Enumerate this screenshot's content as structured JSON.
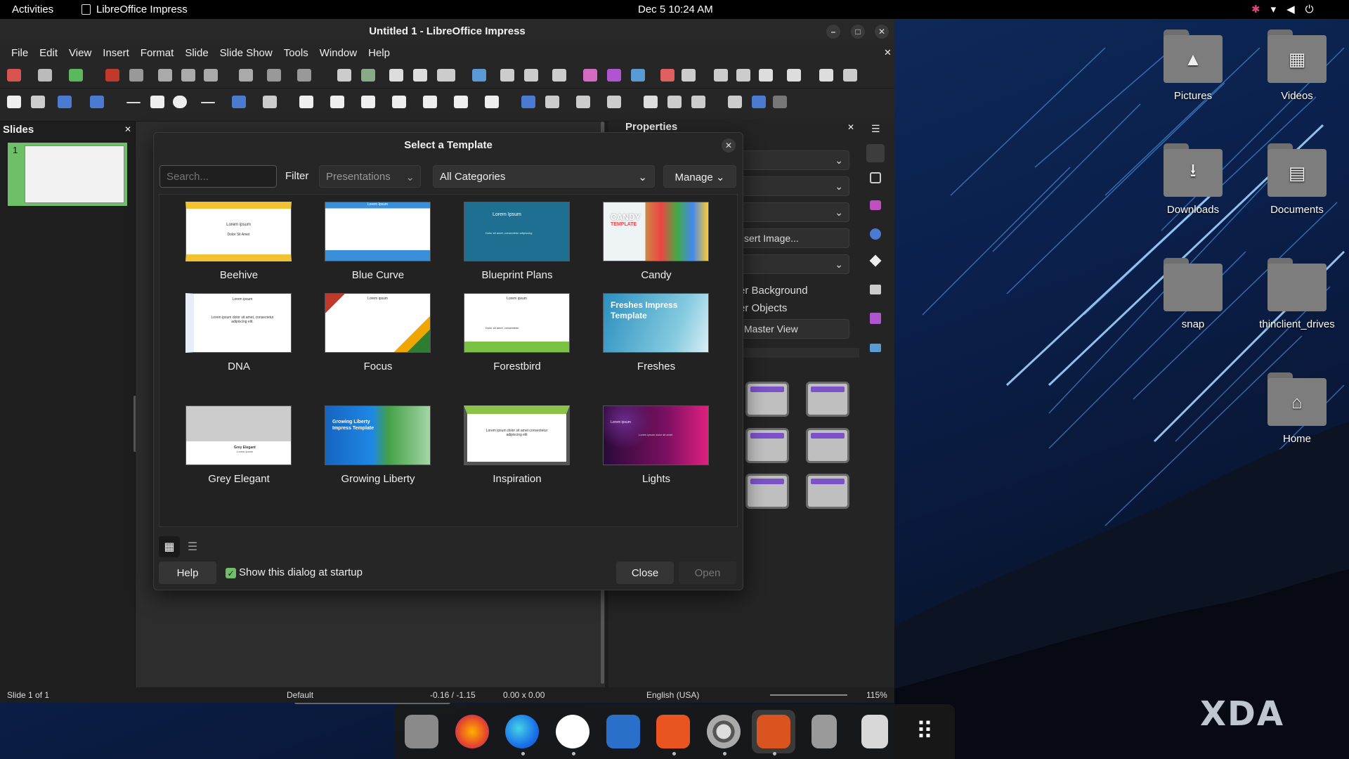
{
  "topbar": {
    "activities": "Activities",
    "app_name": "LibreOffice Impress",
    "clock": "Dec 5  10:24 AM"
  },
  "window": {
    "title": "Untitled 1 - LibreOffice Impress"
  },
  "menu": [
    "File",
    "Edit",
    "View",
    "Insert",
    "Format",
    "Slide",
    "Slide Show",
    "Tools",
    "Window",
    "Help"
  ],
  "slides_pane": {
    "title": "Slides",
    "slide_number": "1"
  },
  "properties": {
    "title": "Properties",
    "insert_image": "sert Image...",
    "items": [
      "er Background",
      "er Objects",
      "Master View"
    ]
  },
  "statusbar": {
    "slide": "Slide 1 of 1",
    "master": "Default",
    "position": "-0.16 / -1.15",
    "size": "0.00 x 0.00",
    "language": "English (USA)",
    "zoom": "115%"
  },
  "dialog": {
    "title": "Select a Template",
    "search_placeholder": "Search...",
    "filter_label": "Filter",
    "filter_value": "Presentations",
    "category_value": "All Categories",
    "manage_label": "Manage",
    "templates": [
      {
        "name": "Beehive",
        "t1": "Lorem ipsum",
        "t2": "Dolor Sit Amet"
      },
      {
        "name": "Blue Curve",
        "t1": "Lorem Ipsum",
        "t2": ""
      },
      {
        "name": "Blueprint Plans",
        "t1": "Lorem Ipsum",
        "t2": "Dolor sit amet, consectetur adipiscing"
      },
      {
        "name": "Candy",
        "t1": "CANDY",
        "t2": "TEMPLATE"
      },
      {
        "name": "DNA",
        "t1": "Lorem ipsum",
        "t2": "Lorem ipsum dolor sit amet, consectetur adipiscing elit."
      },
      {
        "name": "Focus",
        "t1": "Lorem ipsum",
        "t2": ""
      },
      {
        "name": "Forestbird",
        "t1": "Lorem ipsum",
        "t2": "Dolor sit amet, consectetur"
      },
      {
        "name": "Freshes",
        "t1": "Freshes Impress Template",
        "t2": ""
      },
      {
        "name": "Grey Elegant",
        "t1": "Grey Elegant",
        "t2": "Lorem ipsum"
      },
      {
        "name": "Growing Liberty",
        "t1": "Growing Liberty Impress Template",
        "t2": ""
      },
      {
        "name": "Inspiration",
        "t1": "Lorem ipsum",
        "t2": "Lorem ipsum dolor sit amet consectetur adipiscing elit"
      },
      {
        "name": "Lights",
        "t1": "Lorem ipsum",
        "t2": "Lorem ipsum dolor sit amet"
      }
    ],
    "help_label": "Help",
    "startup_checkbox_label": "Show this dialog at startup",
    "startup_checked": true,
    "close_label": "Close",
    "open_label": "Open"
  },
  "desktop_icons": [
    {
      "label": "Pictures",
      "glyph": "▲"
    },
    {
      "label": "Videos",
      "glyph": "▦"
    },
    {
      "label": "Downloads",
      "glyph": "⭳"
    },
    {
      "label": "Documents",
      "glyph": "▤"
    },
    {
      "label": "snap",
      "glyph": ""
    },
    {
      "label": "thinclient_drives",
      "glyph": ""
    },
    {
      "label": "Home",
      "glyph": "⌂"
    }
  ],
  "watermark": "XDA",
  "colors": {
    "accent_green": "#6fbf68",
    "layout_purple": "#7b52c9"
  }
}
